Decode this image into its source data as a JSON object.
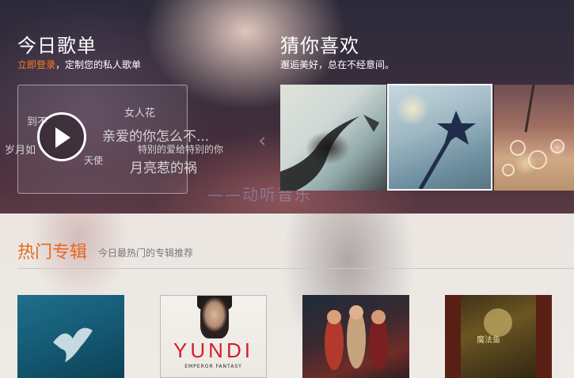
{
  "today_playlist": {
    "title": "今日歌单",
    "login_link": "立即登录",
    "subtitle_rest": "，定制您的私人歌单",
    "word_cloud": [
      "女人花",
      "到不",
      "亲爱的你怎么不...",
      "岁月如",
      "天使",
      "特别的爱给特别的你",
      "月亮惹的祸"
    ]
  },
  "guess_you_like": {
    "title": "猜你喜欢",
    "subtitle": "邂逅美好，总在不经意间。"
  },
  "watermark": "——动听音乐",
  "hot_albums": {
    "title": "热门专辑",
    "subtitle": "今日最热门的专辑推荐",
    "albums": [
      {
        "cover_text": ""
      },
      {
        "cover_text": "YUNDI",
        "cover_sub": "EMPEROR FANTASY"
      },
      {
        "cover_text": ""
      },
      {
        "cover_text": "魔法鱼"
      }
    ]
  },
  "colors": {
    "accent": "#e8681e",
    "login": "#ff7a22",
    "yundi_red": "#d11f2c"
  }
}
